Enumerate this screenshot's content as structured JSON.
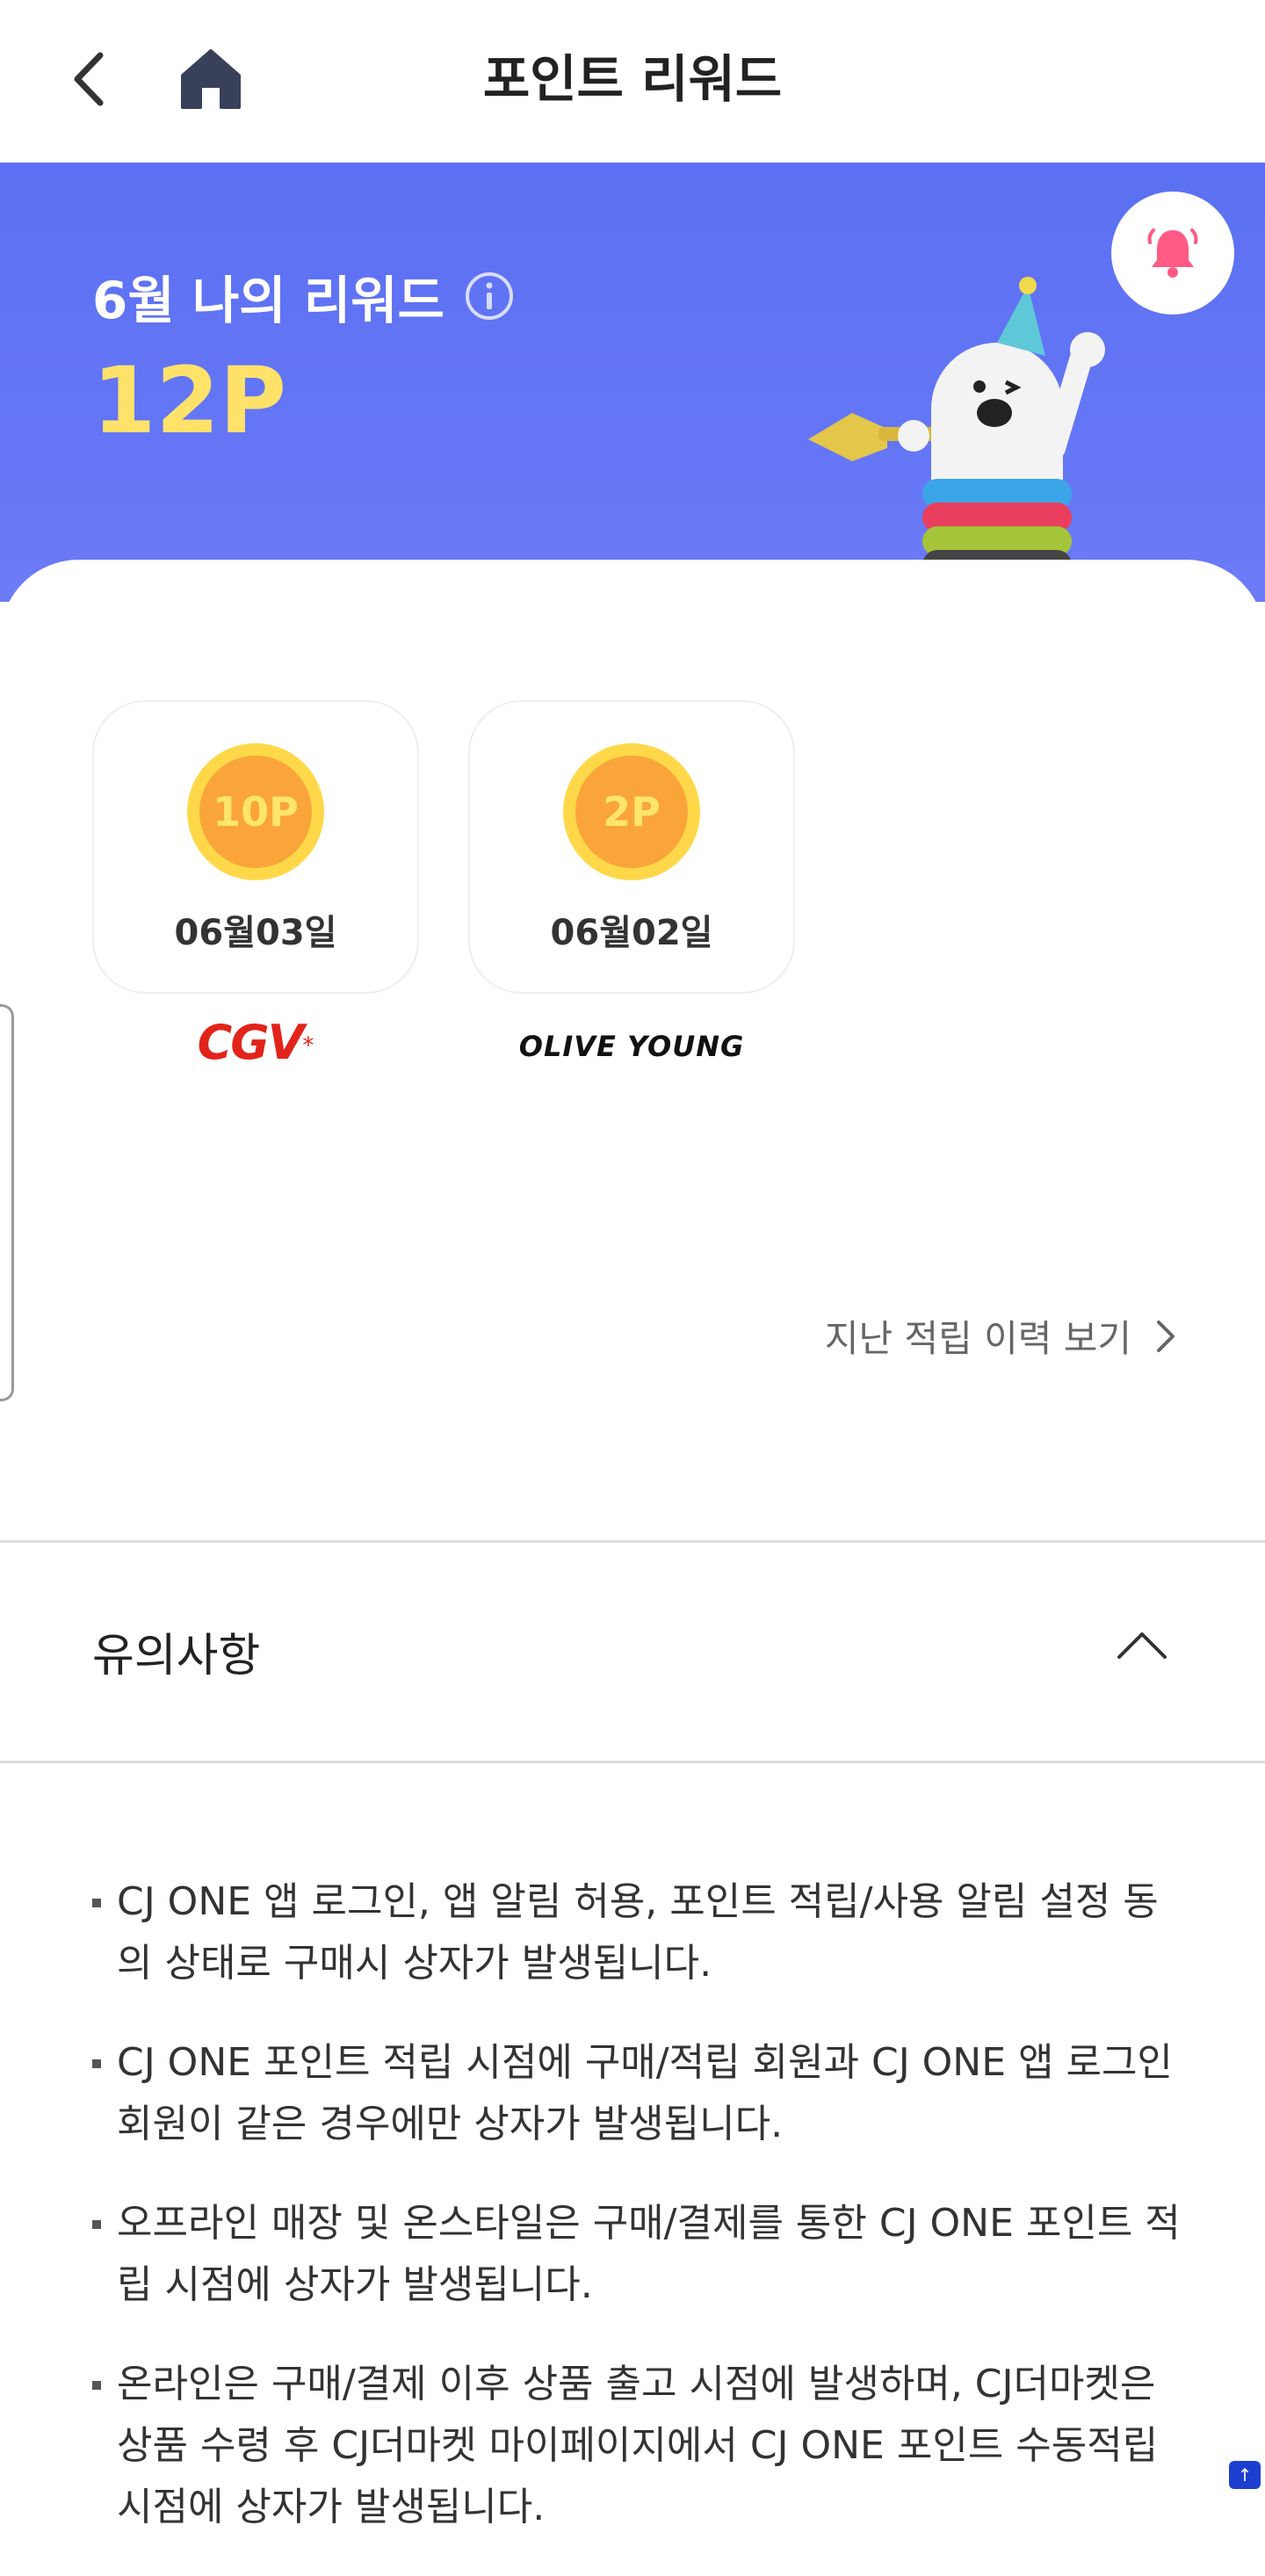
{
  "header": {
    "title": "포인트 리워드",
    "back_icon": "chevron-left-icon",
    "home_icon": "home-icon"
  },
  "hero": {
    "month_label": "6월 나의 리워드",
    "points": "12P",
    "bell_icon": "bell-icon",
    "colors": {
      "background": "#5b70f2",
      "points": "#ffe26a",
      "bell": "#ff5b84"
    }
  },
  "rewards": [
    {
      "coin_label": "10P",
      "date": "06월03일",
      "brand": "CGV"
    },
    {
      "coin_label": "2P",
      "date": "06월02일",
      "brand": "OLIVE YOUNG"
    }
  ],
  "history_link": "지난 적립 이력 보기",
  "notice": {
    "title": "유의사항",
    "items": [
      "CJ ONE 앱 로그인, 앱 알림 허용, 포인트 적립/사용 알림 설정 동의 상태로 구매시 상자가 발생됩니다.",
      "CJ ONE 포인트 적립 시점에 구매/적립 회원과 CJ ONE 앱 로그인 회원이 같은 경우에만 상자가 발생됩니다.",
      "오프라인 매장 및 온스타일은 구매/결제를 통한 CJ ONE 포인트 적립 시점에 상자가 발생됩니다.",
      "온라인은 구매/결제 이후 상품 출고 시점에 발생하며, CJ더마켓은 상품 수령 후 CJ더마켓 마이페이지에서 CJ ONE 포인트 수동적립 시점에 상자가 발생됩니다."
    ]
  },
  "scroll_top_label": "↑"
}
